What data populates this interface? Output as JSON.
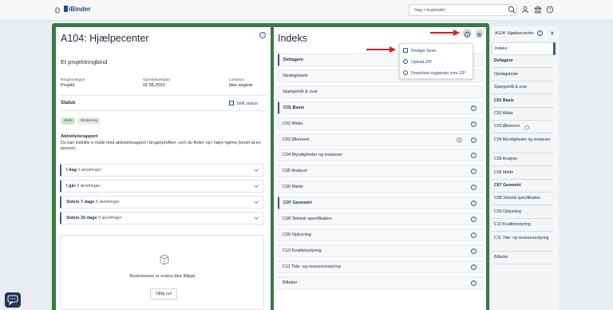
{
  "topbar": {
    "logo": "iBinder",
    "search_placeholder": "Søg i ringbindet"
  },
  "left": {
    "title": "A104: Hjælpecenter",
    "subtitle": "Et projektringbind",
    "meta": [
      {
        "label": "Ringbindstype",
        "value": "Projekt"
      },
      {
        "label": "Oprettelsesdato",
        "value": "01.05.2023"
      },
      {
        "label": "Lokation",
        "value": "Ikke angivet"
      }
    ],
    "status_label": "Status",
    "skift_status": "Skift status",
    "chips": [
      "Aktiv",
      "Skitsering"
    ],
    "activity_title": "Aktivitetsrapport",
    "activity_text": "Du kan indstille e-mails med aktivitetsrapport i brugerprofilen, som du finder op i højre hjørne (konet af en person).",
    "accordions": [
      {
        "label": "I dag",
        "count": "0 ændringer"
      },
      {
        "label": "I går",
        "count": "0 ændringer"
      },
      {
        "label": "Sidste 7 dage",
        "count": "0 ændringer"
      },
      {
        "label": "Sidste 30 dage",
        "count": "0 ændringer"
      }
    ],
    "description_empty": "Beskrivelsen er endnu ikke tilføjet.",
    "add_button": "Tilføj nu!"
  },
  "index": {
    "title": "Indeks",
    "menu": [
      "Rediger faner",
      "Upload ZIP",
      "Download ringbindet som ZIP"
    ],
    "rows": [
      {
        "label": "Deltagere",
        "bold": true
      },
      {
        "label": "Opslagstavle",
        "bold": false
      },
      {
        "label": "Spørgsmål & svar",
        "bold": false
      },
      {
        "label": "C01 Basis",
        "bold": true
      },
      {
        "label": "C02 Aftale",
        "bold": false
      },
      {
        "label": "C03 Økonomi",
        "bold": false
      },
      {
        "label": "C04 Myndigheder og instanser",
        "bold": false
      },
      {
        "label": "C05 Analyse",
        "bold": false
      },
      {
        "label": "C06 Møde",
        "bold": false
      },
      {
        "label": "C07 Geometri",
        "bold": true
      },
      {
        "label": "C08 Teknisk specifikation",
        "bold": false
      },
      {
        "label": "C09 Oplysning",
        "bold": false
      },
      {
        "label": "C10 Kvalitetsstyring",
        "bold": false
      },
      {
        "label": "C11 Tids- og ressourcestyring",
        "bold": false
      },
      {
        "label": "Billeder",
        "bold": false
      }
    ]
  },
  "right": {
    "header": "A104: Hjælpecenter",
    "items": [
      {
        "label": "Indeks",
        "bold": false
      },
      {
        "label": "Deltagere",
        "bold": true
      },
      {
        "label": "Opslagstavle",
        "bold": false
      },
      {
        "label": "Spørgsmål & svar",
        "bold": false
      },
      {
        "label": "C01 Basis",
        "bold": true
      },
      {
        "label": "C02 Aftale",
        "bold": false
      },
      {
        "label": "C03 Økonomi",
        "bold": false
      },
      {
        "label": "C04 Myndigheder og instanser",
        "bold": false
      },
      {
        "label": "C05 Analyse",
        "bold": false
      },
      {
        "label": "C06 Møde",
        "bold": false
      },
      {
        "label": "C07 Geometri",
        "bold": true
      },
      {
        "label": "C08 Teknisk specifikation",
        "bold": false
      },
      {
        "label": "C09 Oplysning",
        "bold": false
      },
      {
        "label": "C10 Kvalitetsstyring",
        "bold": false
      },
      {
        "label": "C11 Tids- og ressourcestyring",
        "bold": false
      },
      {
        "label": "Billeder",
        "bold": false
      }
    ]
  },
  "colors": {
    "accent": "#2f5f93",
    "frame_green": "#3a7a46",
    "arrow_red": "#d32020"
  }
}
